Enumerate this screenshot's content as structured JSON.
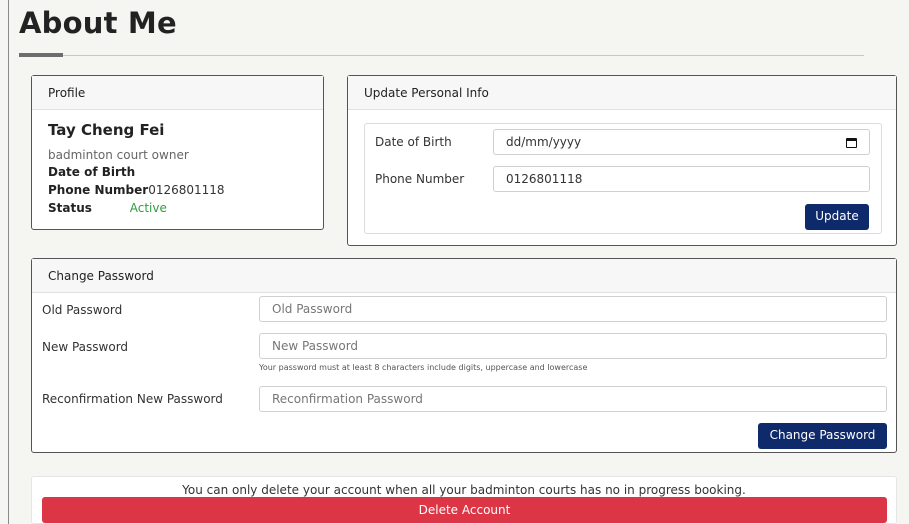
{
  "page": {
    "title": "About Me"
  },
  "profile": {
    "header": "Profile",
    "name": "Tay Cheng Fei",
    "role": "badminton court owner",
    "dob_label": "Date of Birth",
    "dob_value": "",
    "phone_label": "Phone Number",
    "phone_value": "0126801118",
    "status_label": "Status",
    "status_value": "Active",
    "status_color": "#2e9e3e"
  },
  "update_info": {
    "header": "Update Personal Info",
    "dob_label": "Date of Birth",
    "dob_value": "dd/mm/yyyy",
    "phone_label": "Phone Number",
    "phone_value": "0126801118",
    "button": "Update",
    "calendar_icon": "calendar-icon"
  },
  "change_password": {
    "header": "Change Password",
    "old_label": "Old Password",
    "old_placeholder": "Old Password",
    "new_label": "New Password",
    "new_placeholder": "New Password",
    "hint": "Your password must at least 8 characters include digits, uppercase and lowercase",
    "confirm_label": "Reconfirmation New Password",
    "confirm_placeholder": "Reconfirmation Password",
    "button": "Change Password"
  },
  "delete_account": {
    "note": "You can only delete your account when all your badminton courts has no in progress booking.",
    "button": "Delete Account"
  },
  "colors": {
    "primary": "#0f2a6b",
    "danger": "#dc3545",
    "success": "#2e9e3e"
  }
}
